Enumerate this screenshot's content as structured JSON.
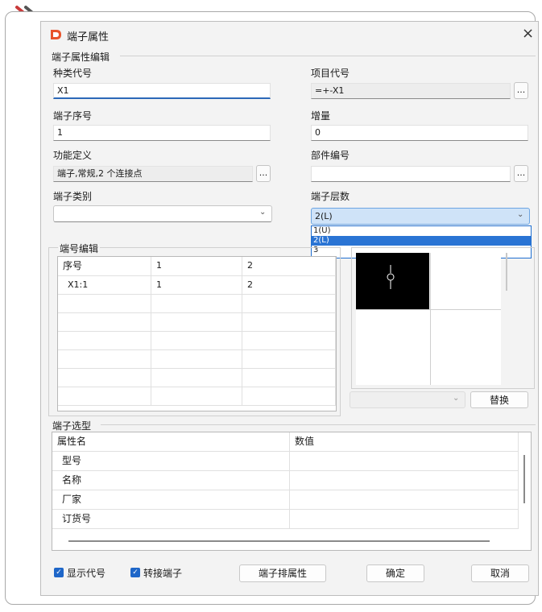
{
  "window": {
    "title": "端子属性",
    "close_icon": "×"
  },
  "edit_group": {
    "label": "端子属性编辑"
  },
  "fields": {
    "type_code": {
      "label": "种类代号",
      "value": "X1"
    },
    "project_code": {
      "label": "项目代号",
      "value": "=+-X1"
    },
    "terminal_number": {
      "label": "端子序号",
      "value": "1"
    },
    "increment": {
      "label": "增量",
      "value": "0"
    },
    "function_def": {
      "label": "功能定义",
      "value": "端子,常规,2 个连接点"
    },
    "part_number": {
      "label": "部件编号",
      "value": ""
    },
    "terminal_category": {
      "label": "端子类别",
      "value": ""
    },
    "terminal_layers": {
      "label": "端子层数",
      "value": "2(L)",
      "options": [
        "1(U)",
        "2(L)",
        "3"
      ],
      "selected_index": 1
    }
  },
  "ellipsis_label": "...",
  "port_group": {
    "label": "端号编辑",
    "header": [
      "序号",
      "1",
      "2"
    ],
    "rows": [
      [
        "X1:1",
        "1",
        "2"
      ]
    ]
  },
  "replace_button": "替换",
  "selection_group": {
    "label": "端子选型",
    "col_name": "属性名",
    "col_value": "数值",
    "rows": [
      "型号",
      "名称",
      "厂家",
      "订货号"
    ]
  },
  "footer": {
    "show_code": {
      "label": "显示代号",
      "checked": true
    },
    "jumper_terminal": {
      "label": "转接端子",
      "checked": true
    },
    "sort_props_button": "端子排属性",
    "ok_button": "确定",
    "cancel_button": "取消"
  },
  "colors": {
    "accent": "#2a74d4",
    "logo": "#e8532b",
    "preview_bg": "#000000"
  }
}
